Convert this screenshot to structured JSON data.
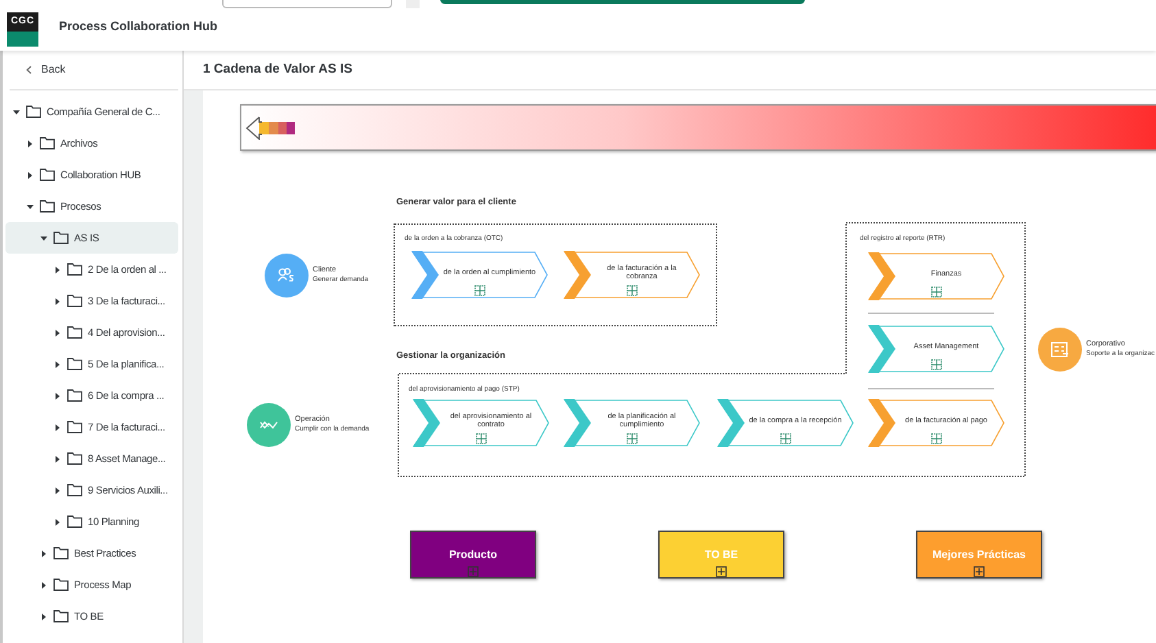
{
  "header": {
    "logo": "CGC",
    "title": "Process Collaboration Hub"
  },
  "sidebar": {
    "back": "Back",
    "tree": [
      {
        "label": "Compañía General de C...",
        "expanded": true,
        "selected": false,
        "children": [
          {
            "label": "Archivos",
            "expanded": false,
            "selected": false
          },
          {
            "label": "Collaboration HUB",
            "expanded": false,
            "selected": false
          },
          {
            "label": "Procesos",
            "expanded": true,
            "selected": false,
            "children": [
              {
                "label": "AS IS",
                "expanded": true,
                "selected": true,
                "children": [
                  {
                    "label": "2 De la orden al ...",
                    "expanded": false,
                    "selected": false
                  },
                  {
                    "label": "3 De la facturaci...",
                    "expanded": false,
                    "selected": false
                  },
                  {
                    "label": "4 Del aprovision...",
                    "expanded": false,
                    "selected": false
                  },
                  {
                    "label": "5 De la planifica...",
                    "expanded": false,
                    "selected": false
                  },
                  {
                    "label": "6 De la compra ...",
                    "expanded": false,
                    "selected": false
                  },
                  {
                    "label": "7 De la facturaci...",
                    "expanded": false,
                    "selected": false
                  },
                  {
                    "label": "8 Asset Manage...",
                    "expanded": false,
                    "selected": false
                  },
                  {
                    "label": "9 Servicios Auxili...",
                    "expanded": false,
                    "selected": false
                  },
                  {
                    "label": "10 Planning",
                    "expanded": false,
                    "selected": false
                  }
                ]
              },
              {
                "label": "Best Practices",
                "expanded": false,
                "selected": false
              },
              {
                "label": "Process Map",
                "expanded": false,
                "selected": false
              },
              {
                "label": "TO BE",
                "expanded": false,
                "selected": false
              }
            ]
          }
        ]
      }
    ]
  },
  "page_title": "1 Cadena de Valor AS IS",
  "diagram": {
    "sections": [
      "Generar valor para el cliente",
      "Gestionar la organización"
    ],
    "actors": [
      {
        "name": "Cliente",
        "role": "Generar demanda",
        "color": "#55aef5"
      },
      {
        "name": "Operación",
        "role": "Cumplir con la demanda",
        "color": "#3fc49a"
      },
      {
        "name": "Corporativo",
        "role": "Soporte a la organizac",
        "color": "#f7a941"
      }
    ],
    "groups": [
      {
        "label": "de la orden a la cobranza (OTC)",
        "steps": [
          {
            "label": "de la orden al cumplimiento",
            "color": "#55aef5"
          },
          {
            "label": "de la facturación a la cobranza",
            "color": "#f7a030"
          }
        ]
      },
      {
        "label": "del registro al reporte (RTR)",
        "steps": [
          {
            "label": "Finanzas",
            "color": "#f7a030"
          },
          {
            "label": "Asset Management",
            "color": "#3cc8c8"
          }
        ]
      },
      {
        "label": "del aprovisionamiento al pago (STP)",
        "steps": [
          {
            "label": "del aprovisionamiento al contrato",
            "color": "#3cc8c8"
          },
          {
            "label": "de la planificación al cumplimiento",
            "color": "#3cc8c8"
          },
          {
            "label": "de la compra a la recepción",
            "color": "#3cc8c8"
          },
          {
            "label": "de la facturación al pago",
            "color": "#f7a030"
          }
        ]
      }
    ],
    "buttons": [
      {
        "label": "Producto",
        "color": "#800080"
      },
      {
        "label": "TO BE",
        "color": "#fcd033"
      },
      {
        "label": "Mejores Prácticas",
        "color": "#fd9e2e"
      }
    ]
  }
}
